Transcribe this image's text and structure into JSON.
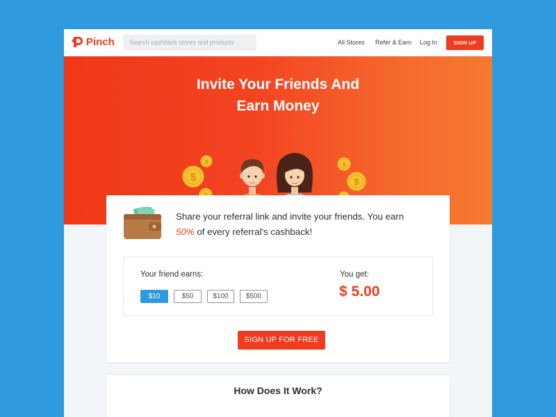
{
  "brand": {
    "name": "Pinch",
    "color": "#f03c1e"
  },
  "nav": {
    "search_placeholder": "Search cashback stores and products",
    "links": [
      "All Stores",
      "Refer & Earn",
      "Log In"
    ],
    "signup_label": "SIGN UP"
  },
  "hero": {
    "title_line1": "Invite Your Friends And",
    "title_line2": "Earn Money",
    "icons": [
      "coin-icon",
      "boy-avatar-icon",
      "girl-avatar-icon"
    ]
  },
  "referral": {
    "text_before": "Share your referral link and invite your friends. You earn",
    "percent": "50%",
    "text_after": "of every referral's cashback!",
    "friend_label": "Your friend earns:",
    "amounts": [
      "$10",
      "$50",
      "$100",
      "$500"
    ],
    "selected_amount": "$10",
    "you_get_label": "You get:",
    "you_get_value": "$ 5.00",
    "cta_label": "SIGN UP FOR FREE"
  },
  "how": {
    "title": "How Does It Work?"
  },
  "colors": {
    "accent": "#f03c1e",
    "selected": "#2f9ade",
    "background": "#2f9ade"
  }
}
